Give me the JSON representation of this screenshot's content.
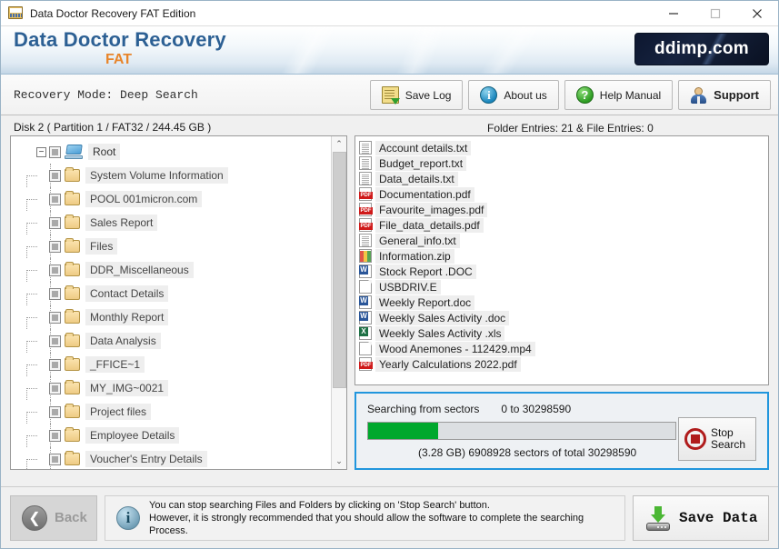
{
  "window": {
    "title": "Data Doctor Recovery FAT Edition",
    "minimize_label": "—",
    "maximize_label": "□",
    "close_label": "✕"
  },
  "brand": {
    "title": "Data Doctor Recovery",
    "subtitle": "FAT",
    "logo": "ddimp.com"
  },
  "toolbar": {
    "recovery_mode": "Recovery Mode:  Deep Search",
    "buttons": [
      {
        "label": "Save Log",
        "icon": "save-log-icon"
      },
      {
        "label": "About us",
        "icon": "about-icon",
        "glyph": "i"
      },
      {
        "label": "Help Manual",
        "icon": "help-icon",
        "glyph": "?"
      },
      {
        "label": "Support",
        "icon": "support-icon"
      }
    ]
  },
  "info": {
    "disk": "Disk 2 ( Partition 1 / FAT32 / 244.45 GB )",
    "entries": "Folder Entries: 21 & File Entries: 0"
  },
  "tree": {
    "root": {
      "label": "Root",
      "expander": "−",
      "icon": "computer-icon"
    },
    "children": [
      {
        "label": "System Volume Information"
      },
      {
        "label": "POOL 001micron.com"
      },
      {
        "label": "Sales Report"
      },
      {
        "label": "Files"
      },
      {
        "label": "DDR_Miscellaneous"
      },
      {
        "label": "Contact Details"
      },
      {
        "label": "Monthly Report"
      },
      {
        "label": "Data Analysis"
      },
      {
        "label": "_FFICE~1"
      },
      {
        "label": "MY_IMG~0021"
      },
      {
        "label": "Project files"
      },
      {
        "label": "Employee Details"
      },
      {
        "label": "Voucher's Entry Details"
      }
    ],
    "scroll_up": "⌃",
    "scroll_down": "⌄"
  },
  "files": [
    {
      "name": "Account details.txt",
      "type": "txt"
    },
    {
      "name": "Budget_report.txt",
      "type": "txt"
    },
    {
      "name": "Data_details.txt",
      "type": "txt"
    },
    {
      "name": "Documentation.pdf",
      "type": "pdf"
    },
    {
      "name": "Favourite_images.pdf",
      "type": "pdf"
    },
    {
      "name": "File_data_details.pdf",
      "type": "pdf"
    },
    {
      "name": "General_info.txt",
      "type": "txt"
    },
    {
      "name": "Information.zip",
      "type": "zip"
    },
    {
      "name": "Stock Report .DOC",
      "type": "doc"
    },
    {
      "name": "USBDRIV.E",
      "type": "blank"
    },
    {
      "name": "Weekly Report.doc",
      "type": "doc"
    },
    {
      "name": "Weekly Sales Activity .doc",
      "type": "doc"
    },
    {
      "name": "Weekly Sales Activity .xls",
      "type": "xls"
    },
    {
      "name": "Wood Anemones - 112429.mp4",
      "type": "blank"
    },
    {
      "name": "Yearly Calculations 2022.pdf",
      "type": "pdf"
    }
  ],
  "search": {
    "label": "Searching from sectors",
    "range": "0 to 30298590",
    "progress_percent": 22.8,
    "status": "(3.28 GB) 6908928   sectors  of  total 30298590",
    "stop_line1": "Stop",
    "stop_line2": "Search",
    "accent_color": "#2196dd",
    "progress_color": "#00a82d"
  },
  "footer": {
    "back_label": "Back",
    "notice_line1": "You can stop searching Files and Folders by clicking on 'Stop Search' button.",
    "notice_line2": "However, it is strongly recommended that you should allow the software to complete the searching",
    "notice_line3": "Process.",
    "save_data_label": "Save Data"
  }
}
